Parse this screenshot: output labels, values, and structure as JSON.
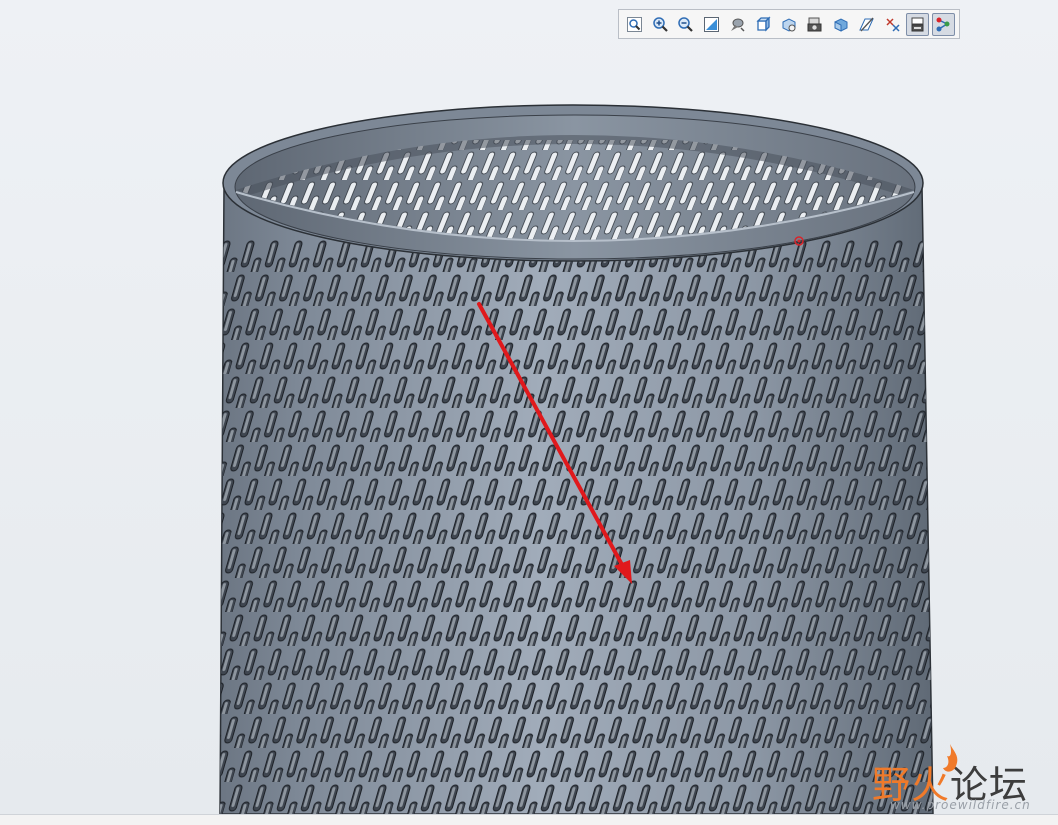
{
  "toolbar": {
    "buttons": [
      {
        "icon": "zoom-to-fit-icon"
      },
      {
        "icon": "zoom-in-icon"
      },
      {
        "icon": "zoom-out-icon"
      },
      {
        "icon": "repaint-icon"
      },
      {
        "icon": "display-style-icon"
      },
      {
        "icon": "saved-orientations-icon"
      },
      {
        "icon": "view-manager-icon"
      },
      {
        "icon": "perspective-view-icon"
      },
      {
        "icon": "appearance-icon"
      },
      {
        "icon": "datum-display-icon"
      },
      {
        "icon": "annotation-display-icon"
      },
      {
        "icon": "spin-center-icon",
        "active": true
      },
      {
        "icon": "model-tree-icon",
        "active": true
      }
    ]
  },
  "model": {
    "name": "perforated-cylinder",
    "body_color": "#8d98a6",
    "annotation_arrow_color": "#e0191c"
  },
  "watermark": {
    "title_orange": "野火",
    "title_dark": "论坛",
    "url": "www.proewildfire.cn"
  }
}
